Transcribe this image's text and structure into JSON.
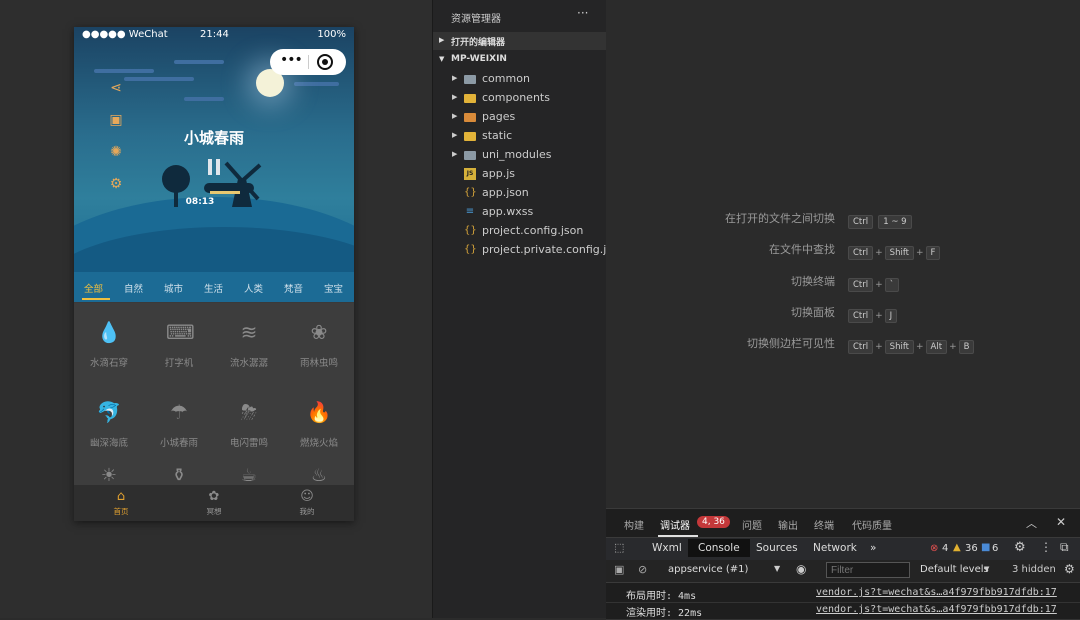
{
  "phone": {
    "status": {
      "signal": "●●●●● WeChat",
      "time": "21:44",
      "battery": "100%"
    },
    "capsule": {
      "dots": "•••"
    },
    "hero_title": "小城春雨",
    "timer": "08:13",
    "tabs": [
      "全部",
      "自然",
      "城市",
      "生活",
      "人类",
      "梵音",
      "宝宝"
    ],
    "grid": [
      {
        "label": "水滴石穿",
        "icon": "water-drop-icon",
        "glyph": "💧"
      },
      {
        "label": "打字机",
        "icon": "typewriter-icon",
        "glyph": "⌨"
      },
      {
        "label": "流水潺潺",
        "icon": "waves-icon",
        "glyph": "≋"
      },
      {
        "label": "雨林虫鸣",
        "icon": "bug-icon",
        "glyph": "❀"
      },
      {
        "label": "幽深海底",
        "icon": "sea-icon",
        "glyph": "🐬"
      },
      {
        "label": "小城春雨",
        "icon": "umbrella-icon",
        "glyph": "☂"
      },
      {
        "label": "电闪雷鸣",
        "icon": "thunder-icon",
        "glyph": "⛈"
      },
      {
        "label": "燃烧火焰",
        "icon": "fire-icon",
        "glyph": "🔥"
      }
    ],
    "nav": [
      {
        "label": "首页",
        "icon": "home-icon",
        "glyph": "⌂"
      },
      {
        "label": "冥想",
        "icon": "meditation-icon",
        "glyph": "✿"
      },
      {
        "label": "我的",
        "icon": "user-icon",
        "glyph": "☺"
      }
    ]
  },
  "explorer": {
    "title": "资源管理器",
    "more": "···",
    "open_editors": "打开的编辑器",
    "project": "MP-WEIXIN",
    "items": [
      {
        "name": "common",
        "kind": "folder",
        "icon": "folder-icon"
      },
      {
        "name": "components",
        "kind": "folder",
        "icon": "components-folder-icon"
      },
      {
        "name": "pages",
        "kind": "folder",
        "icon": "pages-folder-icon"
      },
      {
        "name": "static",
        "kind": "folder",
        "icon": "static-folder-icon"
      },
      {
        "name": "uni_modules",
        "kind": "folder",
        "icon": "folder-icon"
      },
      {
        "name": "app.js",
        "kind": "file",
        "icon": "js-file-icon",
        "glyph": "JS"
      },
      {
        "name": "app.json",
        "kind": "file",
        "icon": "json-file-icon",
        "glyph": "{}"
      },
      {
        "name": "app.wxss",
        "kind": "file",
        "icon": "css-file-icon",
        "glyph": "≡"
      },
      {
        "name": "project.config.json",
        "kind": "file",
        "icon": "json-file-icon",
        "glyph": "{}"
      },
      {
        "name": "project.private.config.js...",
        "kind": "file",
        "icon": "json-file-icon",
        "glyph": "{}"
      }
    ]
  },
  "shortcuts": [
    {
      "label": "在打开的文件之间切换",
      "keys": [
        "Ctrl",
        "1 ~ 9"
      ],
      "joined": false
    },
    {
      "label": "在文件中查找",
      "keys": [
        "Ctrl",
        "Shift",
        "F"
      ],
      "joined": true
    },
    {
      "label": "切换终端",
      "keys": [
        "Ctrl",
        "`"
      ],
      "joined": true
    },
    {
      "label": "切换面板",
      "keys": [
        "Ctrl",
        "J"
      ],
      "joined": true
    },
    {
      "label": "切换侧边栏可见性",
      "keys": [
        "Ctrl",
        "Shift",
        "Alt",
        "B"
      ],
      "joined": true
    }
  ],
  "panel": {
    "tabs": [
      "构建",
      "调试器",
      "问题",
      "输出",
      "终端",
      "代码质量"
    ],
    "debugger_badge": "4, 36",
    "devtools_tabs": [
      "Wxml",
      "Console",
      "Sources",
      "Network"
    ],
    "more": "»",
    "errors": "4",
    "warnings": "36",
    "infos": "6",
    "context": "appservice (#1)",
    "filter_placeholder": "Filter",
    "levels": "Default levels",
    "hidden": "3 hidden",
    "logs": [
      {
        "msg": "布局用时: 4ms",
        "src": "vendor.js?t=wechat&s…a4f979fbb917dfdb:17"
      },
      {
        "msg": "渲染用时: 22ms",
        "src": "vendor.js?t=wechat&s…a4f979fbb917dfdb:17"
      }
    ]
  }
}
